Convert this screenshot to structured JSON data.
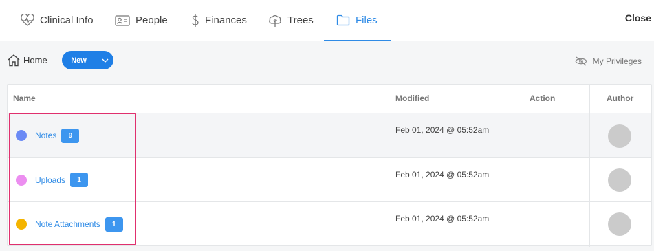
{
  "tabs": [
    {
      "label": "Clinical Info",
      "icon": "heartbeat-icon"
    },
    {
      "label": "People",
      "icon": "id-card-icon"
    },
    {
      "label": "Finances",
      "icon": "dollar-icon"
    },
    {
      "label": "Trees",
      "icon": "tree-icon"
    },
    {
      "label": "Files",
      "icon": "folder-icon",
      "active": true
    }
  ],
  "close_label": "Close",
  "toolbar": {
    "home_label": "Home",
    "new_label": "New",
    "privileges_label": "My Privileges"
  },
  "table": {
    "columns": [
      "Name",
      "Modified",
      "Action",
      "Author"
    ],
    "rows": [
      {
        "name": "Notes",
        "count": "9",
        "color": "#6b8af5",
        "modified": "Feb 01, 2024 @ 05:52am"
      },
      {
        "name": "Uploads",
        "count": "1",
        "color": "#ec8ef0",
        "modified": "Feb 01, 2024 @ 05:52am"
      },
      {
        "name": "Note Attachments",
        "count": "1",
        "color": "#f4b400",
        "modified": "Feb 01, 2024 @ 05:52am"
      }
    ]
  },
  "colors": {
    "accent": "#2f8be6",
    "highlight": "#e0306e"
  }
}
